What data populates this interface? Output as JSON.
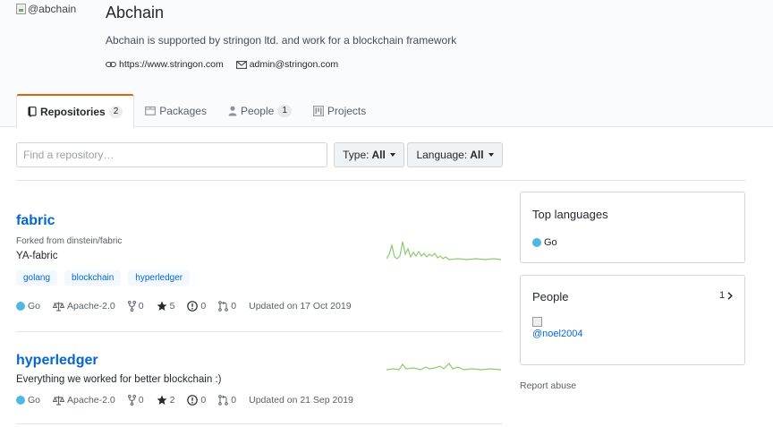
{
  "org": {
    "avatar_alt": "@abchain",
    "name": "Abchain",
    "description": "Abchain is supported by stringon ltd. and work for a blockchain framework",
    "website": "https://www.stringon.com",
    "email": "admin@stringon.com"
  },
  "tabs": [
    {
      "label": "Repositories",
      "count": "2",
      "icon": "repo-icon"
    },
    {
      "label": "Packages",
      "icon": "package-icon"
    },
    {
      "label": "People",
      "count": "1",
      "icon": "person-icon"
    },
    {
      "label": "Projects",
      "icon": "project-icon"
    }
  ],
  "filters": {
    "search_placeholder": "Find a repository…",
    "type_label": "Type:",
    "type_value": "All",
    "language_label": "Language:",
    "language_value": "All"
  },
  "repos": [
    {
      "name": "fabric",
      "forked_from": "Forked from dinstein/fabric",
      "description": "YA-fabric",
      "topics": [
        "golang",
        "blockchain",
        "hyperledger"
      ],
      "language": "Go",
      "license": "Apache-2.0",
      "forks": "0",
      "stars": "5",
      "issues": "0",
      "pulls": "0",
      "updated": "Updated on 17 Oct 2019"
    },
    {
      "name": "hyperledger",
      "description": "Everything we worked for better blockchain :)",
      "language": "Go",
      "license": "Apache-2.0",
      "forks": "0",
      "stars": "2",
      "issues": "0",
      "pulls": "0",
      "updated": "Updated on 21 Sep 2019"
    }
  ],
  "sidebar": {
    "top_languages_title": "Top languages",
    "top_language": "Go",
    "people_title": "People",
    "people_count": "1",
    "person_alt": "@noel2004",
    "report": "Report abuse"
  },
  "colors": {
    "accent_tab": "#e36209",
    "link": "#0366d6",
    "go_language": "#4fb7e4",
    "sparkline": "#8ccc6a"
  }
}
